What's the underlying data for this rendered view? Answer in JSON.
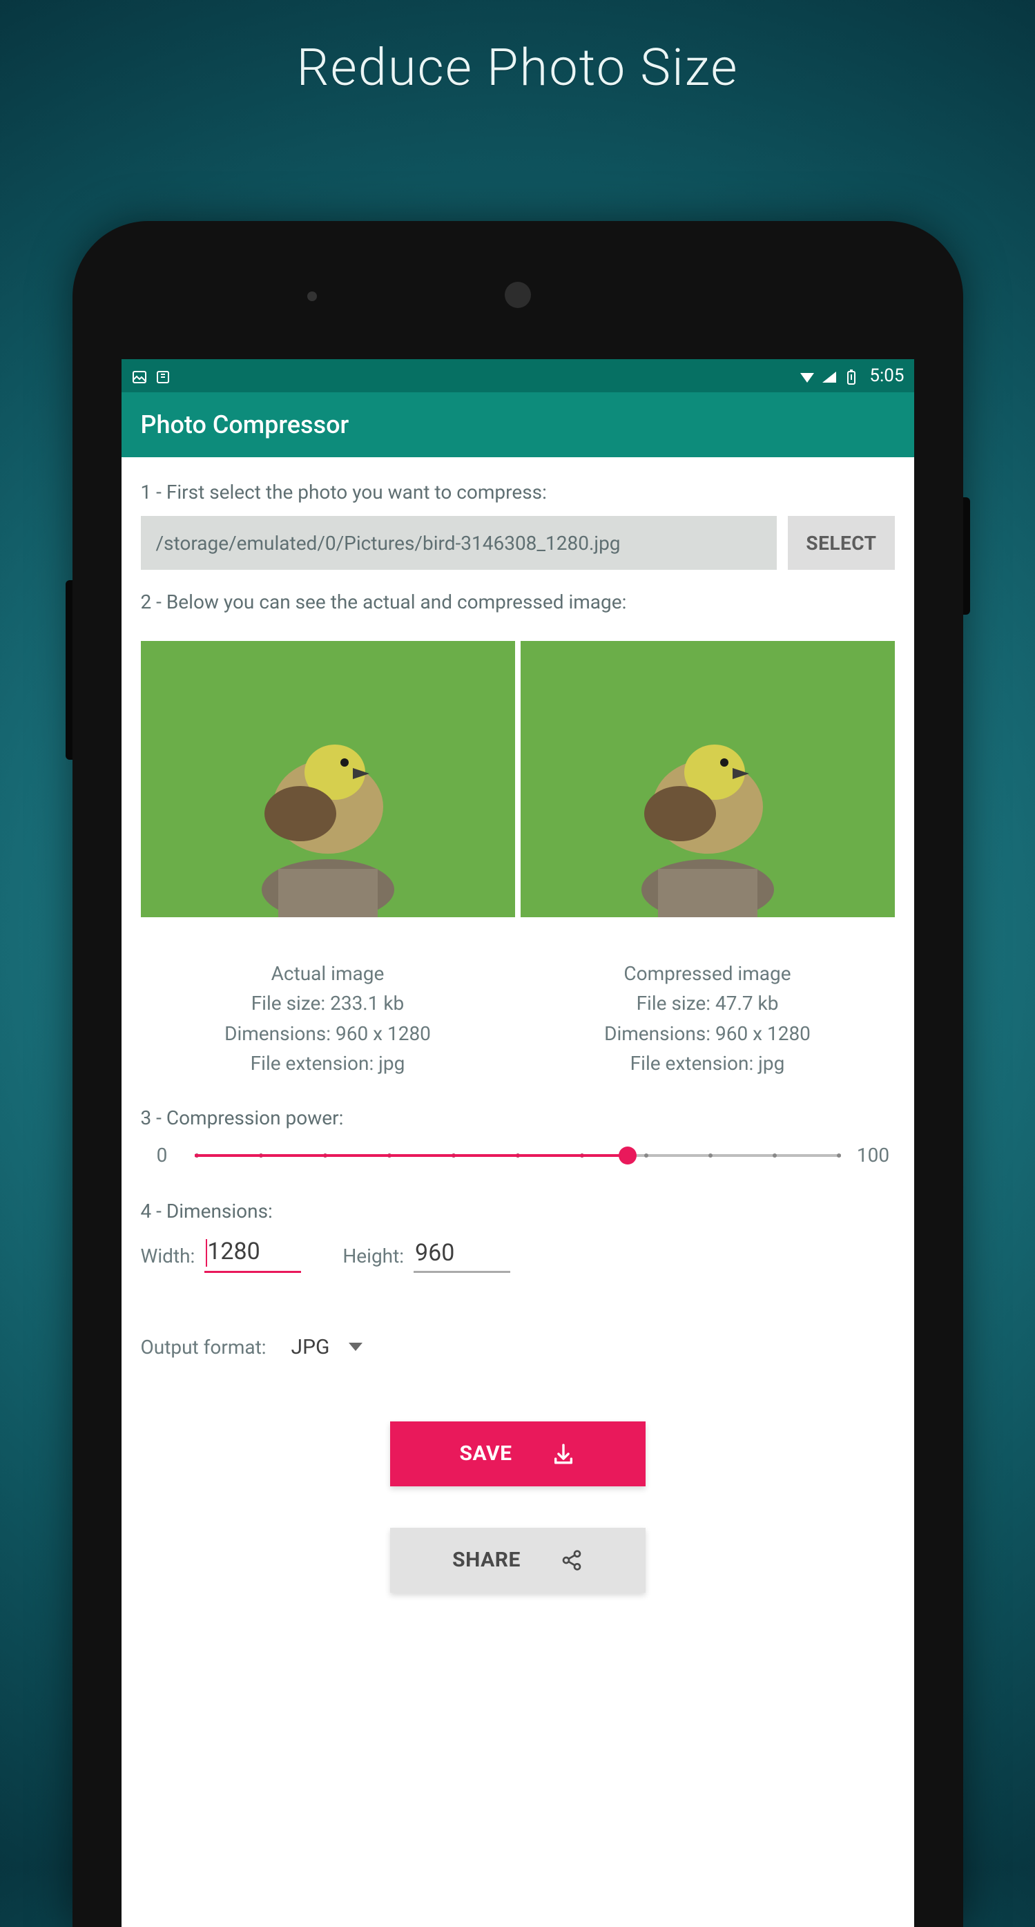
{
  "hero": {
    "title": "Reduce Photo Size"
  },
  "status_bar": {
    "time": "5:05"
  },
  "app_bar": {
    "title": "Photo Compressor"
  },
  "step1": {
    "label": "1 - First select the photo you want to compress:",
    "path": "/storage/emulated/0/Pictures/bird-3146308_1280.jpg",
    "select_btn": "SELECT"
  },
  "step2": {
    "label": "2 - Below you can see the actual and compressed image:",
    "actual": {
      "title": "Actual image",
      "size": "File size: 233.1 kb",
      "dims": "Dimensions: 960 x 1280",
      "ext": "File extension:  jpg"
    },
    "compressed": {
      "title": "Compressed image",
      "size": "File size: 47.7 kb",
      "dims": "Dimensions: 960 x 1280",
      "ext": "File extension:  jpg"
    }
  },
  "step3": {
    "label": "3 - Compression power:",
    "min": "0",
    "max": "100"
  },
  "step4": {
    "label": "4 - Dimensions:",
    "width_label": "Width:",
    "width_value": "1280",
    "height_label": "Height:",
    "height_value": "960"
  },
  "output_format": {
    "label": "Output format:",
    "value": "JPG"
  },
  "actions": {
    "save": "SAVE",
    "share": "SHARE"
  }
}
